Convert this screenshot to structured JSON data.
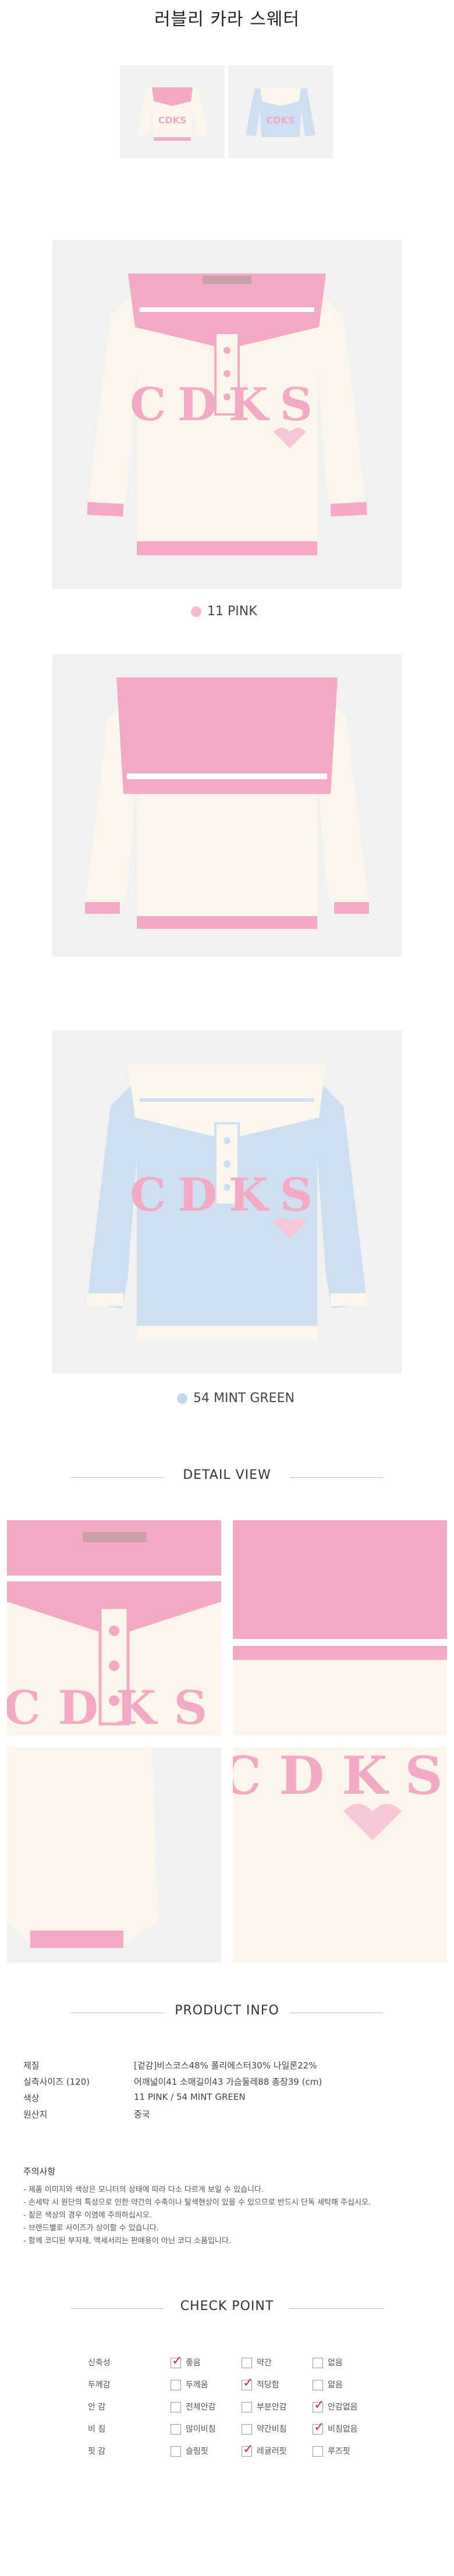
{
  "title": "러블리 카라 스웨터",
  "swatches": [
    {
      "label": "11 PINK",
      "color": "#f7b8cf"
    },
    {
      "label": "54 MINT GREEN",
      "color": "#c6d8e8"
    }
  ],
  "garment_logo": "CDKS",
  "sections": {
    "detail": "DETAIL VIEW",
    "product_info": "PRODUCT INFO",
    "check_point": "CHECK POINT"
  },
  "product_info": [
    {
      "label": "제질",
      "value": "[겉감]비스코스48% 폴리에스터30% 나일론22%"
    },
    {
      "label": "실측사이즈 (120)",
      "value": "어깨넓이41 소매길이43 가슴둘레88 총장39 (cm)"
    },
    {
      "label": "색상",
      "value": "11 PINK / 54 MINT GREEN"
    },
    {
      "label": "원산지",
      "value": "중국"
    }
  ],
  "notes_title": "주의사항",
  "notes": [
    "- 제품 이미지와 색상은 모니터의 상태에 따라 다소 다르게 보일 수 있습니다.",
    "- 손세탁 시 원단의 특성으로 인한 약간의 수축이나 탈색현상이 있을 수 있으므로 반드시 단독 세탁해 주십시오.",
    "- 짙은 색상의 경우 이염에 주의하십시오.",
    "- 브랜드별로 사이즈가 상이할 수 있습니다.",
    "- 함께 코디된 부자재, 액세서리는 판매용이 아닌 코디 소품입니다."
  ],
  "check_points": [
    {
      "label": "신축성",
      "options": [
        {
          "text": "좋음",
          "checked": true
        },
        {
          "text": "약간",
          "checked": false
        },
        {
          "text": "없음",
          "checked": false
        }
      ]
    },
    {
      "label": "두께감",
      "options": [
        {
          "text": "두께움",
          "checked": false
        },
        {
          "text": "적당함",
          "checked": true
        },
        {
          "text": "얇음",
          "checked": false
        }
      ]
    },
    {
      "label": "안 감",
      "options": [
        {
          "text": "전체안감",
          "checked": false
        },
        {
          "text": "부분안감",
          "checked": false
        },
        {
          "text": "안감없음",
          "checked": true
        }
      ]
    },
    {
      "label": "비 침",
      "options": [
        {
          "text": "많이비침",
          "checked": false
        },
        {
          "text": "약간비침",
          "checked": false
        },
        {
          "text": "비침없음",
          "checked": true
        }
      ]
    },
    {
      "label": "핏 감",
      "options": [
        {
          "text": "슬림핏",
          "checked": false
        },
        {
          "text": "레귤러핏",
          "checked": true
        },
        {
          "text": "루즈핏",
          "checked": false
        }
      ]
    }
  ]
}
